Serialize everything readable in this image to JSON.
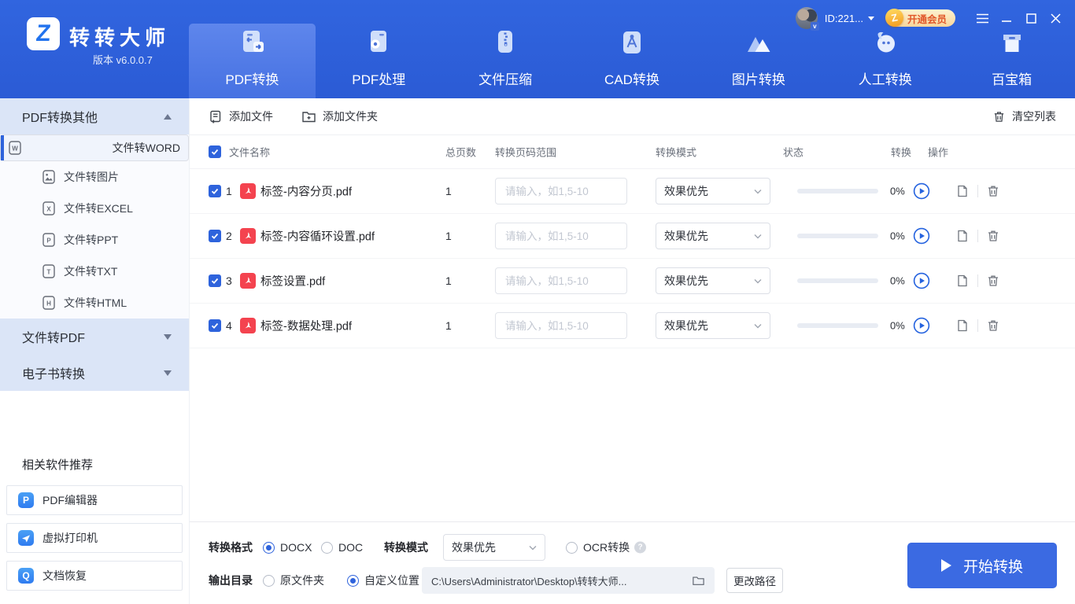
{
  "app": {
    "title": "转转大师",
    "version": "版本 v6.0.0.7",
    "logo_letter": "Z"
  },
  "titlebar": {
    "user_id": "ID:221...",
    "member_badge": "开通会员"
  },
  "nav": {
    "tabs": [
      {
        "label": "PDF转换"
      },
      {
        "label": "PDF处理"
      },
      {
        "label": "文件压缩"
      },
      {
        "label": "CAD转换"
      },
      {
        "label": "图片转换"
      },
      {
        "label": "人工转换"
      },
      {
        "label": "百宝箱"
      }
    ]
  },
  "sidebar": {
    "section_pdf_other": "PDF转换其他",
    "items": [
      {
        "label": "文件转WORD",
        "icon": "W"
      },
      {
        "label": "文件转图片",
        "icon": "IMG"
      },
      {
        "label": "文件转EXCEL",
        "icon": "X"
      },
      {
        "label": "文件转PPT",
        "icon": "P"
      },
      {
        "label": "文件转TXT",
        "icon": "T"
      },
      {
        "label": "文件转HTML",
        "icon": "H"
      }
    ],
    "section_to_pdf": "文件转PDF",
    "section_ebook": "电子书转换",
    "recommend_title": "相关软件推荐",
    "recommend_apps": [
      {
        "label": "PDF编辑器",
        "icon_letter": "P"
      },
      {
        "label": "虚拟打印机",
        "icon_letter": ""
      },
      {
        "label": "文档恢复",
        "icon_letter": "Q"
      }
    ]
  },
  "toolbar": {
    "add_file": "添加文件",
    "add_folder": "添加文件夹",
    "clear_list": "清空列表"
  },
  "table": {
    "headers": {
      "name": "文件名称",
      "pages": "总页数",
      "range": "转换页码范围",
      "mode": "转换模式",
      "status": "状态",
      "convert": "转换",
      "ops": "操作"
    },
    "page_range_placeholder": "请输入，如1,5-10",
    "rows": [
      {
        "index": "1",
        "name": "标签-内容分页.pdf",
        "pages": "1",
        "mode": "效果优先",
        "progress": "0%"
      },
      {
        "index": "2",
        "name": "标签-内容循环设置.pdf",
        "pages": "1",
        "mode": "效果优先",
        "progress": "0%"
      },
      {
        "index": "3",
        "name": "标签设置.pdf",
        "pages": "1",
        "mode": "效果优先",
        "progress": "0%"
      },
      {
        "index": "4",
        "name": "标签-数据处理.pdf",
        "pages": "1",
        "mode": "效果优先",
        "progress": "0%"
      }
    ]
  },
  "settings": {
    "format_label": "转换格式",
    "format_docx": "DOCX",
    "format_doc": "DOC",
    "mode_label": "转换模式",
    "mode_value": "效果优先",
    "ocr_label": "OCR转换",
    "output_label": "输出目录",
    "output_source": "原文件夹",
    "output_custom": "自定义位置",
    "output_path": "C:\\Users\\Administrator\\Desktop\\转转大师...",
    "change_path": "更改路径"
  },
  "actions": {
    "start": "开始转换"
  },
  "colors": {
    "primary": "#2e62da",
    "active_tab": "#4f7ae7",
    "pdf_red": "#f4434f",
    "badge_text": "#e1572a",
    "sidebar_section": "#dbe5f7"
  }
}
